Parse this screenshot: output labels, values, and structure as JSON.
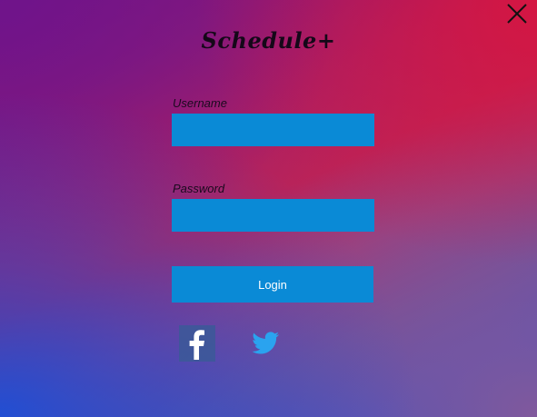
{
  "app": {
    "title": "Schedule+"
  },
  "window": {
    "close_icon": "close-icon"
  },
  "form": {
    "username_label": "Username",
    "username_value": "",
    "password_label": "Password",
    "password_value": "",
    "login_label": "Login"
  },
  "social": {
    "facebook_icon": "facebook-icon",
    "twitter_icon": "twitter-icon"
  },
  "colors": {
    "input_bg": "#0a8ad6",
    "button_bg": "#0a8ad6",
    "facebook_bg": "#3b5998",
    "twitter": "#1da1f2"
  }
}
